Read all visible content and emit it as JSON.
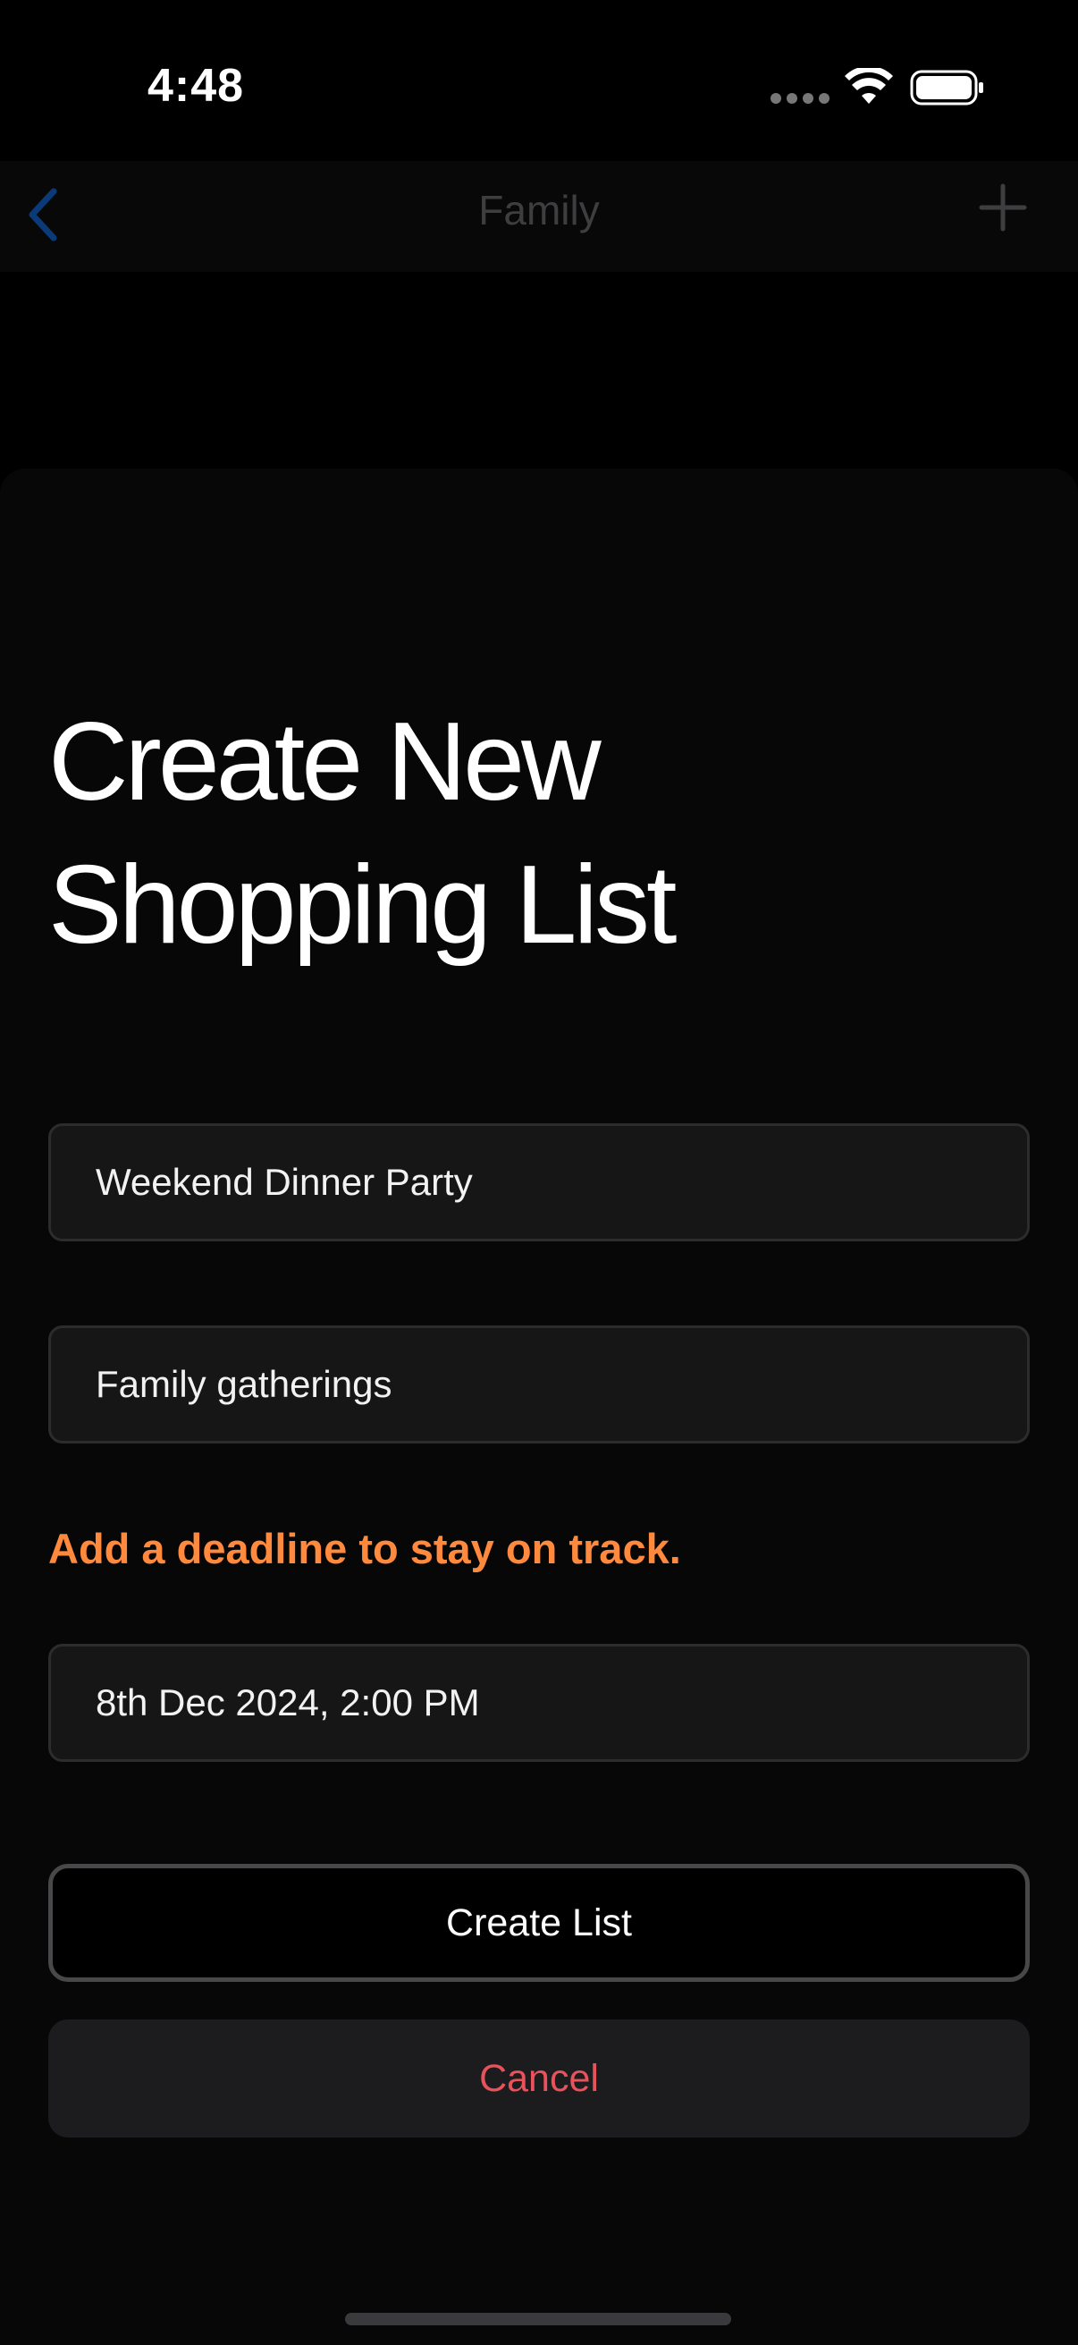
{
  "status_bar": {
    "time": "4:48"
  },
  "nav": {
    "title": "Family",
    "back_icon": "chevron-left-icon",
    "add_icon": "plus-icon"
  },
  "sheet": {
    "title_line1": "Create New",
    "title_line2": "Shopping List",
    "name_field": {
      "value": "Weekend Dinner Party"
    },
    "category_field": {
      "value": "Family gatherings"
    },
    "deadline_hint": "Add a deadline to stay on track.",
    "deadline_field": {
      "value": "8th Dec 2024, 2:00 PM"
    },
    "create_label": "Create List",
    "cancel_label": "Cancel"
  },
  "colors": {
    "accent_orange": "#ff8a3d",
    "cancel_red": "#e8525a",
    "nav_blue": "#0a3a78"
  }
}
